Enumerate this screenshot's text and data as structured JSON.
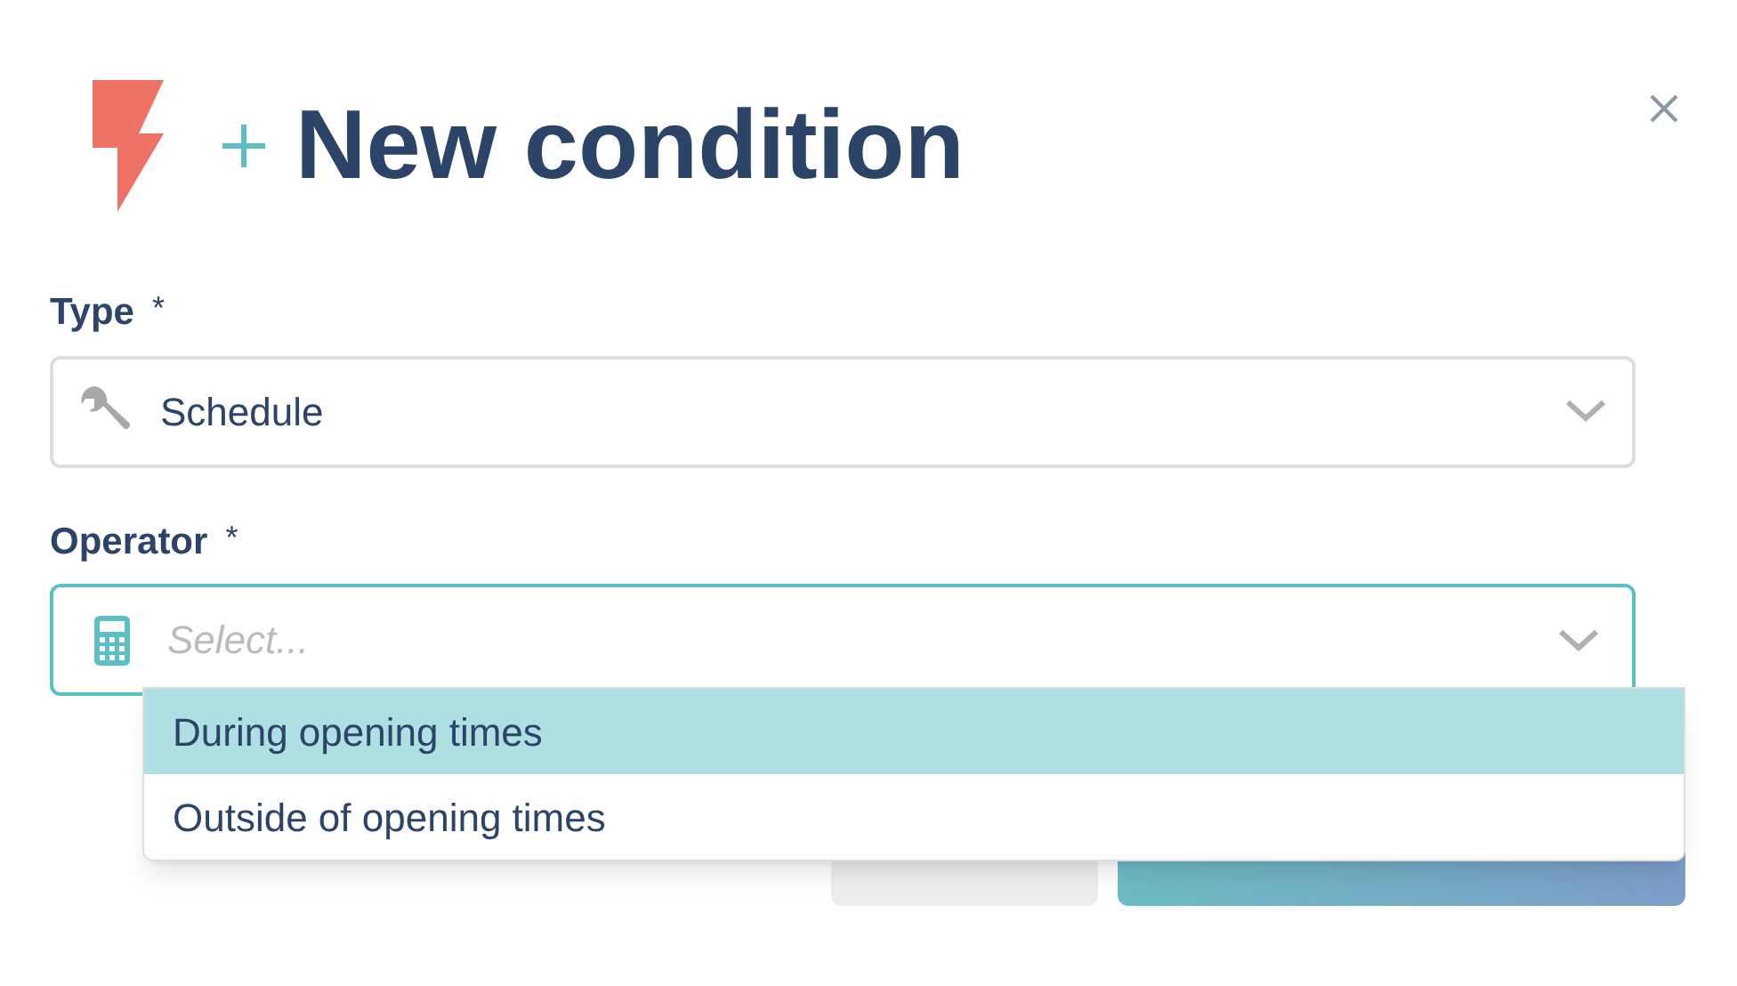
{
  "dialog": {
    "title": "New condition"
  },
  "fields": [
    {
      "label": "Type",
      "required": true,
      "value": "Schedule",
      "focused": false
    },
    {
      "label": "Operator",
      "required": true,
      "placeholder": "Select...",
      "focused": true
    }
  ],
  "required_mark": "*",
  "dropdown": {
    "options": [
      {
        "label": "During opening times",
        "selected": true
      },
      {
        "label": "Outside of opening times",
        "selected": false
      }
    ]
  }
}
